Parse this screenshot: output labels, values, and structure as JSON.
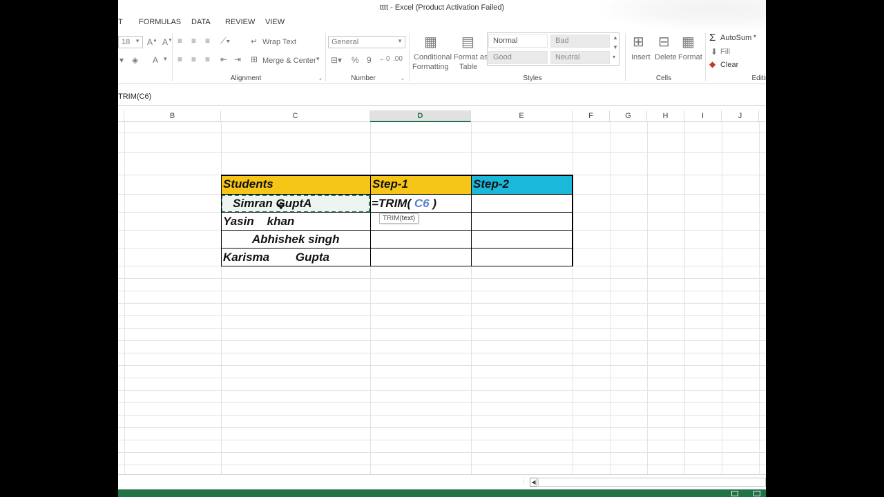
{
  "window": {
    "title": "tttt - Excel (Product Activation Failed)"
  },
  "menu_tabs": [
    "T",
    "FORMULAS",
    "DATA",
    "REVIEW",
    "VIEW"
  ],
  "ribbon": {
    "font_size": "18",
    "wrap_text": "Wrap Text",
    "merge_center": "Merge & Center",
    "alignment_label": "Alignment",
    "number_format": "General",
    "percent": "%",
    "comma": "9",
    "number_label": "Number",
    "conditional_formatting": [
      "Conditional",
      "Formatting"
    ],
    "format_as_table": [
      "Format as",
      "Table"
    ],
    "styles": {
      "normal": "Normal",
      "bad": "Bad",
      "good": "Good",
      "neutral": "Neutral"
    },
    "styles_label": "Styles",
    "insert": "Insert",
    "delete": "Delete",
    "format": "Format",
    "cells_label": "Cells",
    "autosum": "AutoSum",
    "fill": "Fill",
    "clear": "Clear",
    "editing_label": "Editin"
  },
  "formula_bar": {
    "text": "TRIM(C6)"
  },
  "columns": [
    "B",
    "C",
    "D",
    "E",
    "F",
    "G",
    "H",
    "I",
    "J"
  ],
  "active_column": "D",
  "table": {
    "headers": [
      "Students",
      "Step-1",
      "Step-2"
    ],
    "rows": [
      "   Simran GuptA",
      "Yasin    khan",
      "         Abhishek singh",
      "Karisma        Gupta"
    ],
    "editing_formula_prefix": "=TRIM(",
    "editing_ref": " C6",
    "editing_formula_suffix": " )"
  },
  "tooltip": {
    "func": "TRIM(",
    "arg": "text",
    "close": ")"
  },
  "colors": {
    "yellow_header": "#f5c518",
    "blue_header": "#1ab8da",
    "excel_green": "#217346"
  }
}
